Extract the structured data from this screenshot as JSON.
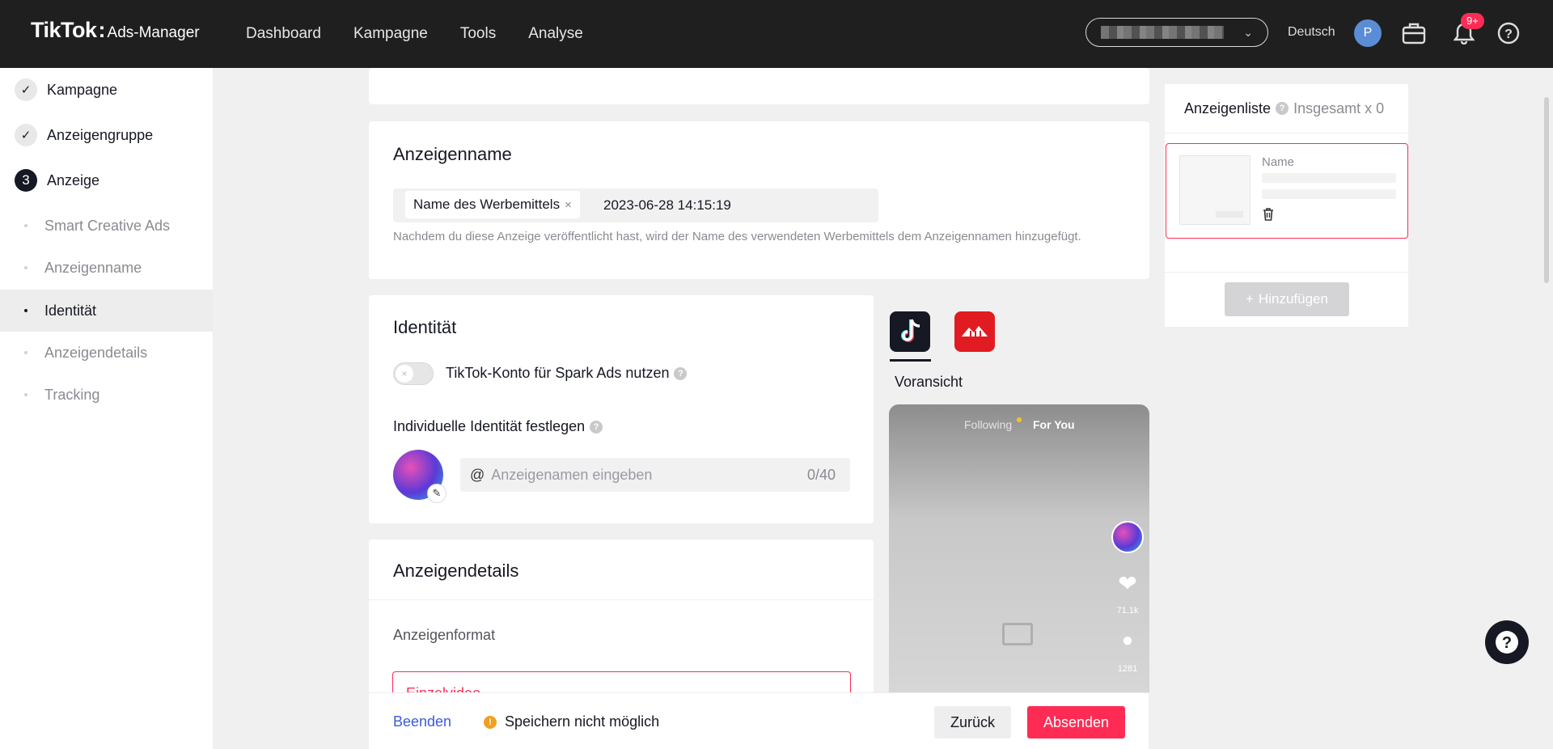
{
  "header": {
    "logo_brand": "TikTok",
    "logo_product": "Ads-Manager",
    "nav": [
      "Dashboard",
      "Kampagne",
      "Tools",
      "Analyse"
    ],
    "language": "Deutsch",
    "avatar_initial": "P",
    "notification_badge": "9+"
  },
  "sidebar": {
    "steps": [
      {
        "label": "Kampagne",
        "marker": "✓"
      },
      {
        "label": "Anzeigengruppe",
        "marker": "✓"
      },
      {
        "label": "Anzeige",
        "marker": "3"
      }
    ],
    "subitems": [
      "Smart Creative Ads",
      "Anzeigenname",
      "Identität",
      "Anzeigendetails",
      "Tracking"
    ],
    "active_subitem": "Identität"
  },
  "adname": {
    "title": "Anzeigenname",
    "chip_label": "Name des Werbemittels",
    "timestamp": "2023-06-28 14:15:19",
    "hint": "Nachdem du diese Anzeige veröffentlicht hast, wird der Name des verwendeten Werbemittels dem Anzeigennamen hinzugefügt."
  },
  "identity": {
    "title": "Identität",
    "spark_toggle_label": "TikTok-Konto für Spark Ads nutzen",
    "spark_toggle_on": false,
    "custom_identity_label": "Individuelle Identität festlegen",
    "name_input_prefix": "@",
    "name_input_placeholder": "Anzeigenamen eingeben",
    "name_input_counter": "0/40"
  },
  "addetails": {
    "title": "Anzeigendetails",
    "format_label": "Anzeigenformat",
    "format_selected": "Einzelvideo"
  },
  "preview": {
    "label": "Voransicht",
    "phone_tab_following": "Following",
    "phone_tab_foryou": "For You",
    "likes": "71.1k",
    "comments": "1281"
  },
  "adlist": {
    "title": "Anzeigenliste",
    "total": "Insgesamt x 0",
    "item_name_label": "Name",
    "add_button": "Hinzufügen"
  },
  "footer": {
    "quit": "Beenden",
    "warning": "Speichern nicht möglich",
    "back": "Zurück",
    "submit": "Absenden"
  },
  "colors": {
    "accent": "#fe2c55",
    "topbar": "#1f1f1f",
    "link": "#3b5bdb",
    "warning": "#f0a020"
  }
}
